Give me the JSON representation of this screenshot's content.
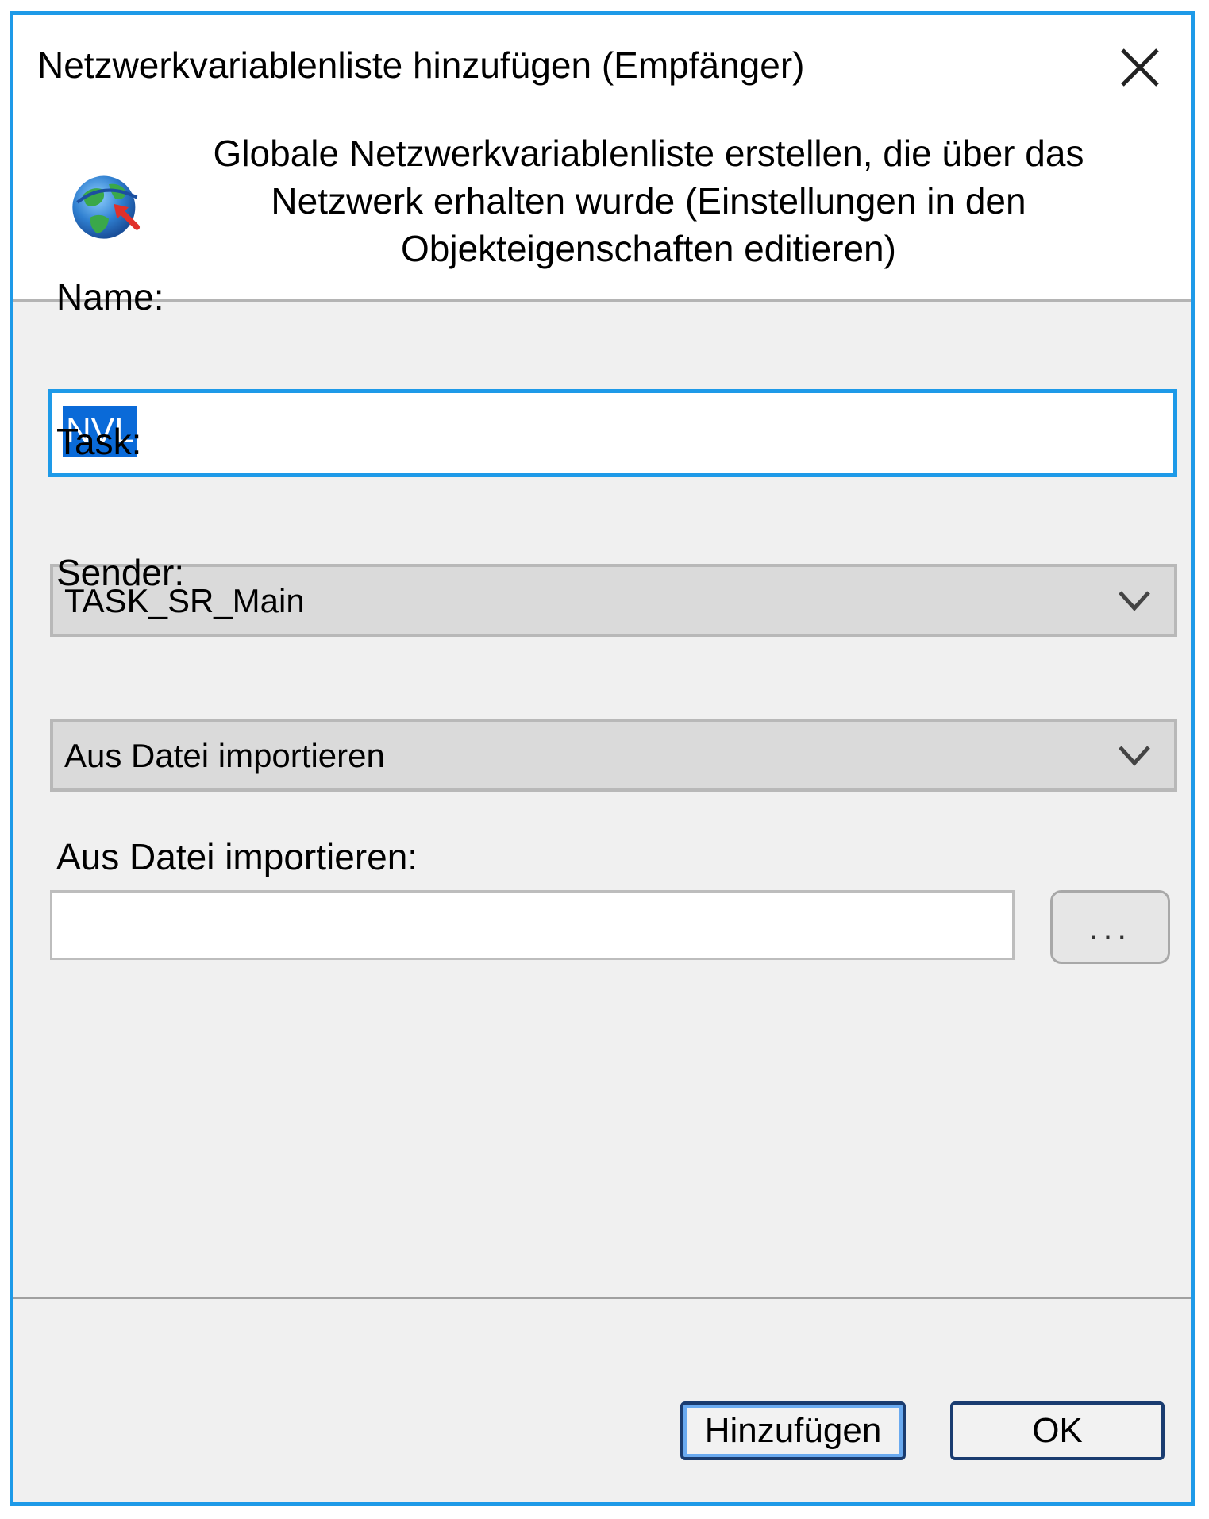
{
  "window": {
    "title": "Netzwerkvariablenliste hinzufügen (Empfänger)",
    "close_icon": "close-icon",
    "accent_color": "#1e9ae8"
  },
  "header": {
    "icon": "network-globe-receive-icon",
    "description": "Globale Netzwerkvariablenliste erstellen, die über das Netzwerk erhalten wurde (Einstellungen in den Objekteigenschaften editieren)"
  },
  "form": {
    "name_label": "Name:",
    "name_value": "NVL",
    "task_label": "Task:",
    "task_value": "TASK_SR_Main",
    "sender_label": "Sender:",
    "sender_value": "Aus Datei importieren",
    "import_label": "Aus Datei importieren:",
    "import_value": "",
    "browse_label": "..."
  },
  "footer": {
    "add_label": "Hinzufügen",
    "ok_label": "OK"
  }
}
